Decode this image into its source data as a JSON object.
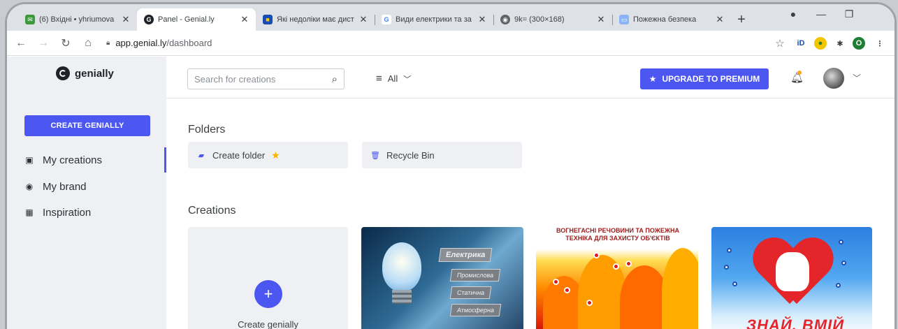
{
  "browser": {
    "tabs": [
      {
        "title": "(6) Вхідні • yhriumova",
        "fav_color": "#3c9a3c",
        "fav_glyph": "✉"
      },
      {
        "title": "Panel - Genial.ly",
        "fav_color": "#1f2329",
        "fav_glyph": "G"
      },
      {
        "title": "Які недоліки має дист",
        "fav_color": "#1a4db3",
        "fav_glyph": "■"
      },
      {
        "title": "Види електрики та за",
        "fav_color": "#4285f4",
        "fav_glyph": "G"
      },
      {
        "title": "9k= (300×168)",
        "fav_color": "#5f6368",
        "fav_glyph": "◉"
      },
      {
        "title": "Пожежна безпека",
        "fav_color": "#8ab4f8",
        "fav_glyph": "▭"
      }
    ],
    "new_tab": "+",
    "window_controls": [
      "●",
      "—",
      "❐"
    ],
    "url_host": "app.genial.ly",
    "url_path": "/dashboard",
    "profile_initial": "O"
  },
  "app": {
    "logo_text": "genially",
    "create_button": "CREATE GENIALLY",
    "sidebar": [
      {
        "label": "My creations",
        "icon": "image-icon"
      },
      {
        "label": "My brand",
        "icon": "brand-icon"
      },
      {
        "label": "Inspiration",
        "icon": "inspiration-icon"
      }
    ],
    "search_placeholder": "Search for creations",
    "filter_label": "All",
    "upgrade_button": "UPGRADE TO PREMIUM",
    "folders_title": "Folders",
    "create_folder": "Create folder",
    "recycle_bin": "Recycle Bin",
    "creations_title": "Creations",
    "create_new_label": "Create genially",
    "thumb1": {
      "main": "Електрика",
      "items": [
        "Промислова",
        "Статична",
        "Атмосферна"
      ]
    },
    "thumb2": {
      "title": "ВОГНЕГАСНІ РЕЧОВИНИ ТА ПОЖЕЖНА ТЕХНІКА ДЛЯ ЗАХИСТУ ОБ'ЄКТІВ"
    },
    "thumb3": {
      "text": "ЗНАЙ, ВМІЙ"
    }
  },
  "colors": {
    "accent": "#4c56f1",
    "sidebar_bg": "#eef0f3"
  }
}
